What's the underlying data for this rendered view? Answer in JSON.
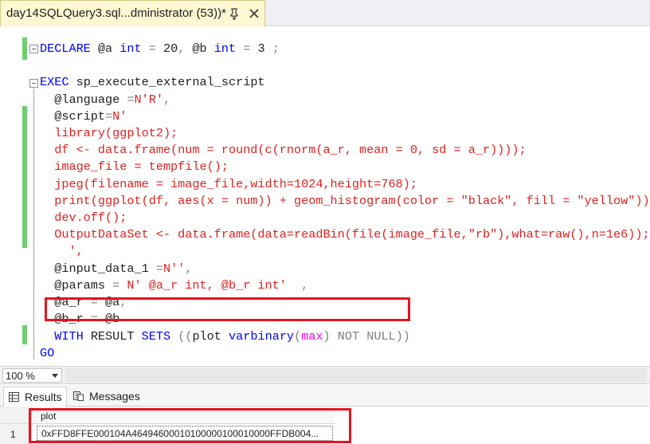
{
  "tab": {
    "title": "day14SQLQuery3.sql...dministrator (53))*",
    "pin_icon": "pin-icon",
    "close_icon": "close-icon"
  },
  "editor": {
    "lines": [
      {
        "segments": [
          {
            "t": "DECLARE",
            "c": "kw"
          },
          {
            "t": " @a ",
            "c": "blk"
          },
          {
            "t": "int",
            "c": "kw"
          },
          {
            "t": " = ",
            "c": "gr"
          },
          {
            "t": "20",
            "c": "blk"
          },
          {
            "t": ", ",
            "c": "gr"
          },
          {
            "t": "@b ",
            "c": "blk"
          },
          {
            "t": "int",
            "c": "kw"
          },
          {
            "t": " = ",
            "c": "gr"
          },
          {
            "t": "3",
            "c": "blk"
          },
          {
            "t": " ;",
            "c": "gr"
          }
        ]
      },
      {
        "segments": [
          {
            "t": "EXEC",
            "c": "kw"
          },
          {
            "t": " sp_execute_external_script",
            "c": "blk"
          }
        ]
      },
      {
        "segments": [
          {
            "t": "  @language ",
            "c": "blk"
          },
          {
            "t": "=",
            "c": "gr"
          },
          {
            "t": "N'R'",
            "c": "str"
          },
          {
            "t": ",",
            "c": "gr"
          }
        ]
      },
      {
        "segments": [
          {
            "t": "  @script",
            "c": "blk"
          },
          {
            "t": "=",
            "c": "gr"
          },
          {
            "t": "N'",
            "c": "str"
          }
        ]
      },
      {
        "segments": [
          {
            "t": "  library(ggplot2);",
            "c": "str"
          }
        ]
      },
      {
        "segments": [
          {
            "t": "  df <- data.frame(num = round(c(rnorm(a_r, mean = 0, sd = a_r))));",
            "c": "str"
          }
        ]
      },
      {
        "segments": [
          {
            "t": "  image_file = tempfile();",
            "c": "str"
          }
        ]
      },
      {
        "segments": [
          {
            "t": "  jpeg(filename = image_file,width=1024,height=768);",
            "c": "str"
          }
        ]
      },
      {
        "segments": [
          {
            "t": "  print(ggplot(df, aes(x = num)) + geom_histogram(color = \"black\", fill = \"yellow\"));",
            "c": "str"
          }
        ]
      },
      {
        "segments": [
          {
            "t": "  dev.off();",
            "c": "str"
          }
        ]
      },
      {
        "segments": [
          {
            "t": "  OutputDataSet <- data.frame(data=readBin(file(image_file,\"rb\"),what=raw(),n=1e6));",
            "c": "str"
          }
        ]
      },
      {
        "segments": [
          {
            "t": "    ',",
            "c": "str"
          }
        ]
      },
      {
        "segments": [
          {
            "t": "  @input_data_1 ",
            "c": "blk"
          },
          {
            "t": "=",
            "c": "gr"
          },
          {
            "t": "N''",
            "c": "str"
          },
          {
            "t": ",",
            "c": "gr"
          }
        ]
      },
      {
        "segments": [
          {
            "t": "  @params ",
            "c": "blk"
          },
          {
            "t": "=",
            "c": "gr"
          },
          {
            "t": " N' @a_r int, @b_r int'",
            "c": "str"
          },
          {
            "t": "  ,",
            "c": "gr"
          }
        ]
      },
      {
        "segments": [
          {
            "t": "  @a_r ",
            "c": "blk"
          },
          {
            "t": "=",
            "c": "gr"
          },
          {
            "t": " @a",
            "c": "blk"
          },
          {
            "t": ",",
            "c": "gr"
          }
        ]
      },
      {
        "segments": [
          {
            "t": "  @b_r ",
            "c": "blk"
          },
          {
            "t": "=",
            "c": "gr"
          },
          {
            "t": " @b",
            "c": "blk"
          }
        ]
      },
      {
        "segments": [
          {
            "t": "  WITH",
            "c": "kw"
          },
          {
            "t": " ",
            "c": "blk"
          },
          {
            "t": "RESULT",
            "c": "blk"
          },
          {
            "t": " ",
            "c": "blk"
          },
          {
            "t": "SETS",
            "c": "kw"
          },
          {
            "t": " ((",
            "c": "gr"
          },
          {
            "t": "plot ",
            "c": "blk"
          },
          {
            "t": "varbinary",
            "c": "kw"
          },
          {
            "t": "(",
            "c": "gr"
          },
          {
            "t": "max",
            "c": "mag"
          },
          {
            "t": ") ",
            "c": "gr"
          },
          {
            "t": "NOT",
            "c": "gr"
          },
          {
            "t": " ",
            "c": "gr"
          },
          {
            "t": "NULL",
            "c": "gr"
          },
          {
            "t": "))",
            "c": "gr"
          }
        ]
      },
      {
        "segments": [
          {
            "t": "GO",
            "c": "kw"
          }
        ]
      }
    ]
  },
  "zoom": {
    "value": "100 %"
  },
  "results_tabs": {
    "results_label": "Results",
    "messages_label": "Messages"
  },
  "grid": {
    "column_header": "plot",
    "row_number": "1",
    "cell_value": "0xFFD8FFE000104A46494600010100000100010000FFDB004..."
  },
  "colors": {
    "highlight": "#e8141e",
    "change_bar": "#6fcf6f",
    "keyword": "#0000ff",
    "string": "#e02020"
  }
}
